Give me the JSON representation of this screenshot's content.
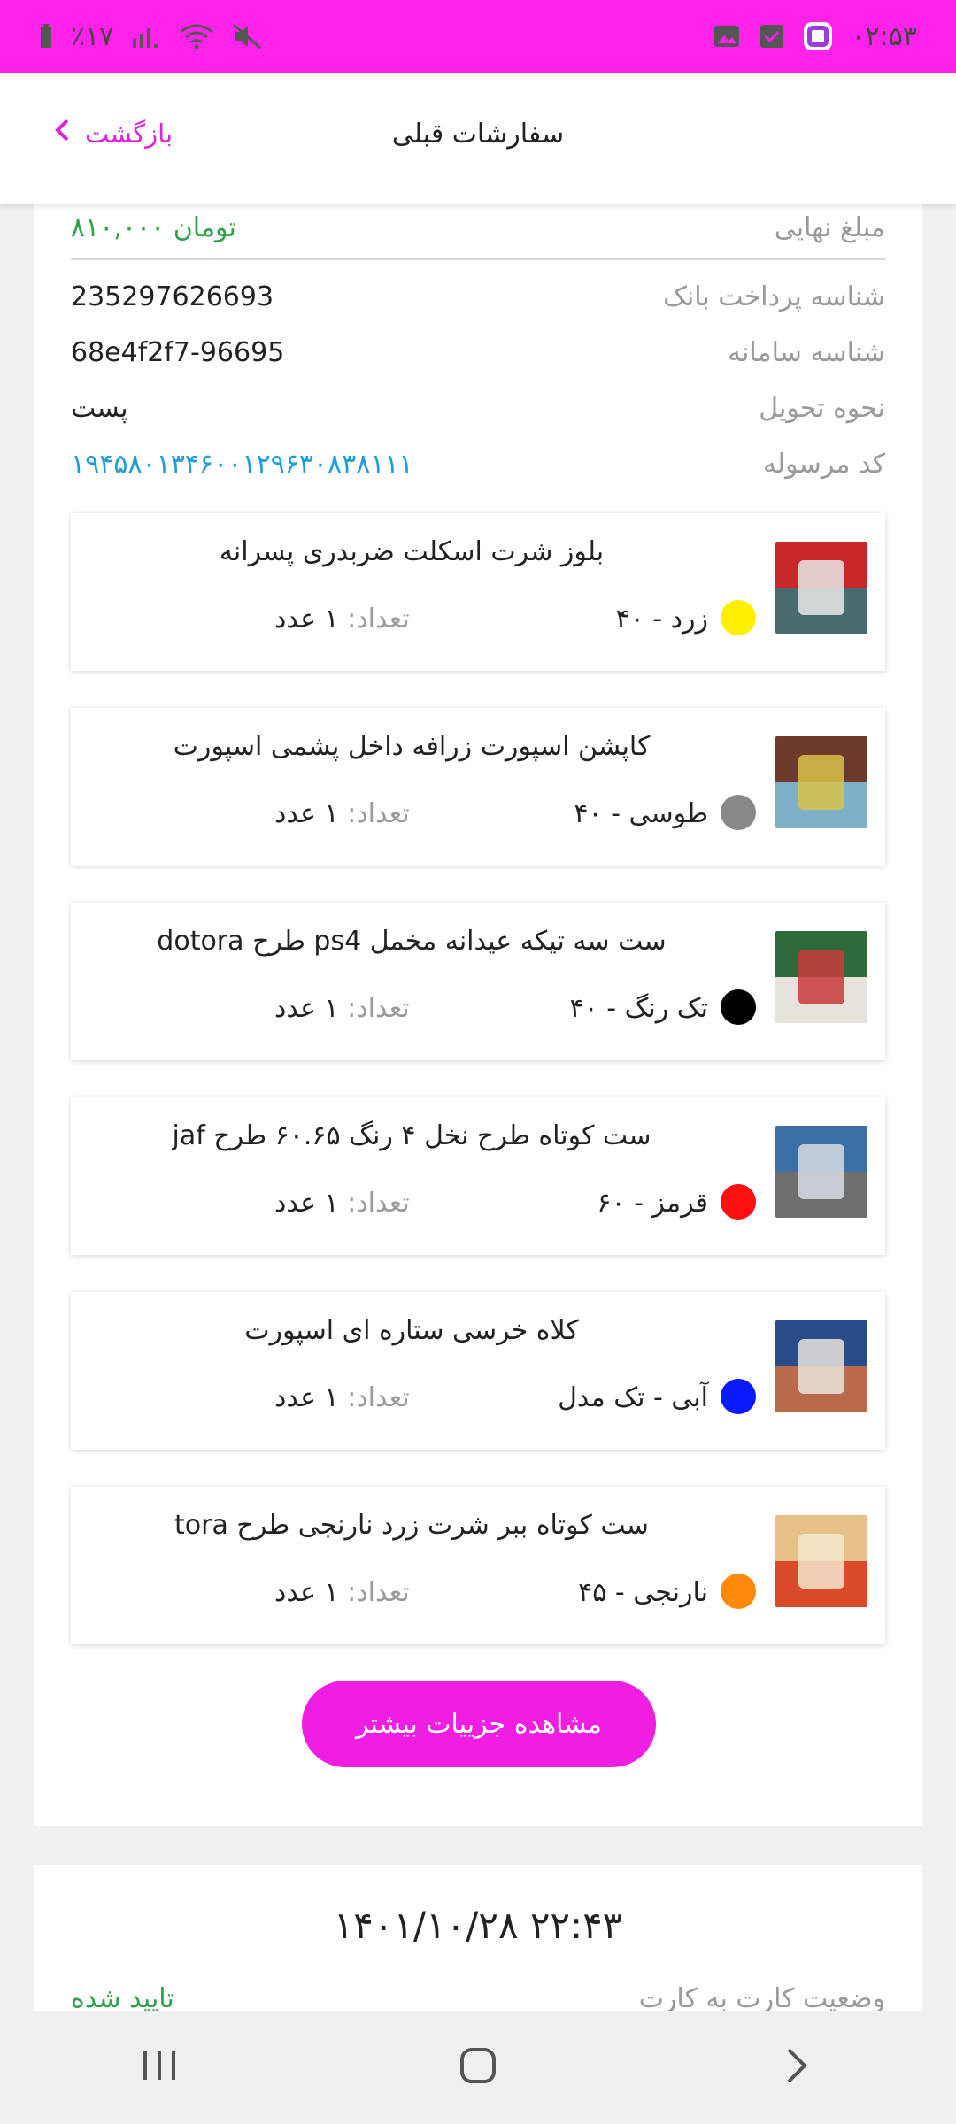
{
  "status_bar": {
    "time": "۰۲:۵۳",
    "battery": "٪۱۷",
    "colors": {
      "bg": "#ff22e8"
    }
  },
  "header": {
    "title": "سفارشات قبلی",
    "back_label": "بازگشت",
    "accent": "#e022d6"
  },
  "order": {
    "rows": [
      {
        "label": "مبلغ نهایی",
        "value": "۸۱۰,۰۰۰ تومان"
      },
      {
        "label": "شناسه پرداخت بانک",
        "value": "235297626693"
      },
      {
        "label": "شناسه سامانه",
        "value": "68e4f2f7-96695"
      },
      {
        "label": "نحوه تحویل",
        "value": "پست"
      },
      {
        "label": "کد مرسوله",
        "value": "۱۹۴۵۸۰۱۳۴۶۰۰۱۲۹۶۳۰۸۳۸۱۱۱"
      }
    ],
    "qty_label": "تعداد:",
    "items": [
      {
        "title": "بلوز شرت اسکلت ضربدری پسرانه",
        "variant": "زرد  -  ۴۰",
        "color": "#fff000",
        "qty": "۱ عدد",
        "thumb": [
          "#c8282a",
          "#4a6b6e",
          "#e8e8e8"
        ]
      },
      {
        "title": "کاپشن اسپورت زرافه داخل پشمی اسپورت",
        "variant": "طوسی  -  ۴۰",
        "color": "#888888",
        "qty": "۱ عدد",
        "thumb": [
          "#6b3a2a",
          "#7fb0c8",
          "#d9c24a"
        ]
      },
      {
        "title": "ست سه تیکه عیدانه مخمل ps4 طرح dotora",
        "variant": "تک رنگ  -  ۴۰",
        "color": "#000000",
        "qty": "۱ عدد",
        "thumb": [
          "#2f6a3a",
          "#e6e2dc",
          "#c83a3a"
        ]
      },
      {
        "title": "ست کوتاه طرح نخل ۴ رنگ ۶۰.۶۵ طرح jaf",
        "variant": "قرمز  -  ۶۰",
        "color": "#ff1010",
        "qty": "۱ عدد",
        "thumb": [
          "#3b6fa8",
          "#6f6f6f",
          "#d9dde4"
        ]
      },
      {
        "title": "کلاه خرسی ستاره ای اسپورت",
        "variant": "آبی  -  تک مدل",
        "color": "#0a1aff",
        "qty": "۱ عدد",
        "thumb": [
          "#2b4c8a",
          "#b86a4a",
          "#e9e4dc"
        ]
      },
      {
        "title": "ست کوتاه ببر شرت زرد نارنجی طرح tora",
        "variant": "نارنجی  -  ۴۵",
        "color": "#ff8a0a",
        "qty": "۱ عدد",
        "thumb": [
          "#e8c08a",
          "#d94a2a",
          "#f5e6cc"
        ]
      }
    ],
    "more_button": "مشاهده جزییات بیشتر"
  },
  "order2": {
    "date": "۱۴۰۱/۱۰/۲۸ ۲۲:۴۳",
    "status_label": "وضعیت کارت به کارت",
    "status_value": "تایید شده"
  },
  "nav": {
    "icons": [
      "recent-apps-icon",
      "home-icon",
      "back-icon"
    ]
  }
}
